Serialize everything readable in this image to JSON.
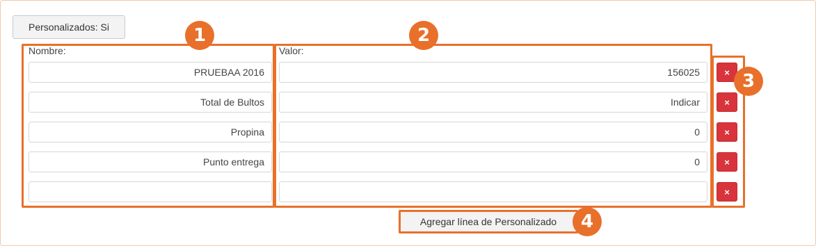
{
  "toolbar": {
    "custom_toggle_label": "Personalizados: Si"
  },
  "columns": {
    "name_header": "Nombre:",
    "value_header": "Valor:"
  },
  "rows": [
    {
      "name": "PRUEBAA 2016",
      "value": "156025"
    },
    {
      "name": "Total de Bultos",
      "value": "Indicar"
    },
    {
      "name": "Propina",
      "value": "0"
    },
    {
      "name": "Punto entrega",
      "value": "0"
    },
    {
      "name": "",
      "value": ""
    }
  ],
  "delete_label": "×",
  "add_row_label": "Agregar línea de Personalizado",
  "badges": [
    "1",
    "2",
    "3",
    "4"
  ],
  "colors": {
    "accent": "#e8702a",
    "danger": "#d9343b"
  },
  "icons": {
    "delete": "close-icon"
  }
}
